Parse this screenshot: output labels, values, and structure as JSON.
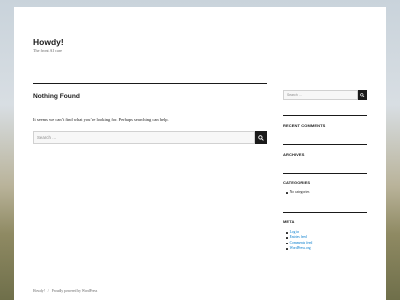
{
  "site": {
    "title": "Howdy!",
    "description": "The front AI care"
  },
  "main": {
    "page_title": "Nothing Found",
    "message": "It seems we can’t find what you’re looking for. Perhaps searching can help.",
    "search_placeholder": "Search …"
  },
  "sidebar": {
    "search_placeholder": "Search …",
    "widgets": {
      "recent_comments": "RECENT COMMENTS",
      "archives": "ARCHIVES",
      "categories": {
        "title": "CATEGORIES",
        "items": [
          "No categories"
        ]
      },
      "meta": {
        "title": "META",
        "items": [
          "Log in",
          "Entries feed",
          "Comments feed",
          "WordPress.org"
        ]
      }
    }
  },
  "footer": {
    "site_name": "Howdy!",
    "separator": "/",
    "powered_by": "Proudly powered by WordPress"
  },
  "colors": {
    "text": "#1a1a1a",
    "link": "#007acc",
    "muted": "#686868",
    "background": "#ffffff"
  },
  "icons": [
    "search-icon"
  ]
}
